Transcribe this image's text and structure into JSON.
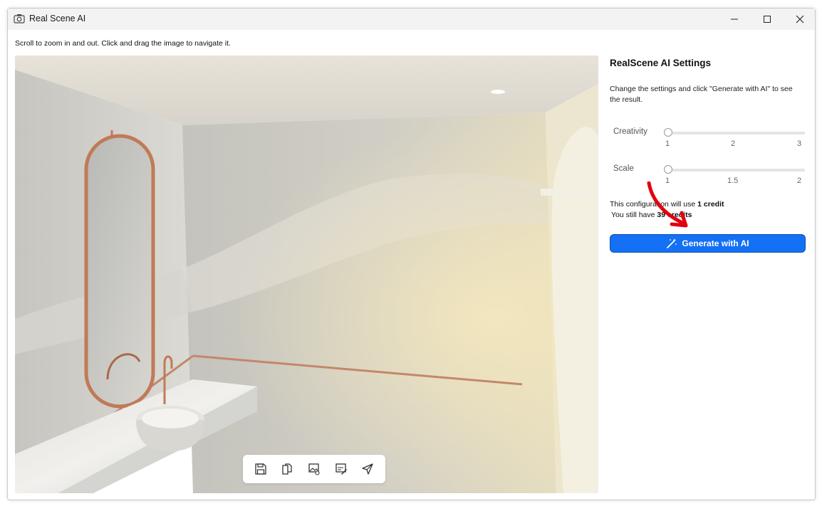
{
  "window": {
    "title": "Real Scene AI",
    "icons": {
      "app": "camera-icon",
      "minimize": "minimize-icon",
      "maximize": "maximize-icon",
      "close": "close-icon"
    }
  },
  "viewer": {
    "hint": "Scroll to zoom in and out. Click and drag the image to navigate it.",
    "image_subject": "bathroom-render",
    "toolbar": [
      {
        "name": "save-icon"
      },
      {
        "name": "copy-icon"
      },
      {
        "name": "image-settings-icon"
      },
      {
        "name": "edit-image-icon"
      },
      {
        "name": "send-icon"
      }
    ]
  },
  "settings": {
    "title": "RealScene AI Settings",
    "description": "Change the settings and click \"Generate with AI\" to see the result.",
    "sliders": [
      {
        "label": "Creativity",
        "ticks": [
          "1",
          "2",
          "3"
        ],
        "value": 1,
        "min": 1,
        "max": 3
      },
      {
        "label": "Scale",
        "ticks": [
          "1",
          "1.5",
          "2"
        ],
        "value": 1,
        "min": 1,
        "max": 2
      }
    ],
    "credits": {
      "use_prefix": "This configuration will use ",
      "use_amount": "1 credit",
      "have_prefix": "You still have ",
      "have_amount": "39 credits"
    },
    "generate_label": "Generate with AI",
    "generate_icon": "magic-wand-icon",
    "accent_color": "#1470f5",
    "annotation_arrow_color": "#e3000f"
  }
}
